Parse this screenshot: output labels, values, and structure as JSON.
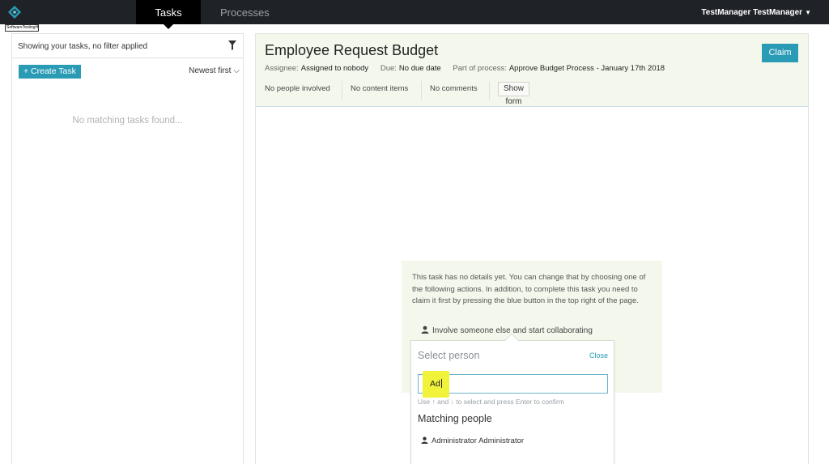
{
  "nav": {
    "tasks_label": "Tasks",
    "processes_label": "Processes",
    "user_name": "TestManager TestManager"
  },
  "watermark_text": "SoftwareTestingHelp",
  "task_list": {
    "filter_text": "Showing your tasks, no filter applied",
    "create_task_label": "+ Create Task",
    "sort_label": "Newest first",
    "empty_message": "No matching tasks found..."
  },
  "task": {
    "title": "Employee Request Budget",
    "claim_label": "Claim",
    "assignee_label": "Assignee:",
    "assignee_value": "Assigned to nobody",
    "due_label": "Due:",
    "due_value": "No due date",
    "process_label": "Part of process:",
    "process_value": "Approve Budget Process - January 17th 2018",
    "people": "No people involved",
    "content": "No content items",
    "comments": "No comments",
    "show_form_label": "Show form"
  },
  "details": {
    "text": "This task has no details yet. You can change that by choosing one of the following actions. In addition, to complete this task you need to claim it first by pressing the blue button in the top right of the page.",
    "involve_label": "Involve someone else and start collaborating"
  },
  "select_person": {
    "title": "Select person",
    "close_label": "Close",
    "input_value": "Ad",
    "hint": "Use ↑ and ↓ to select and press Enter to confirm",
    "matching_title": "Matching people",
    "matches": [
      "Administrator Administrator"
    ]
  },
  "colors": {
    "accent": "#2a9bb5",
    "topbar": "#1f2328",
    "panel_bg": "#f4f8ec",
    "highlight": "#f1f33a"
  }
}
